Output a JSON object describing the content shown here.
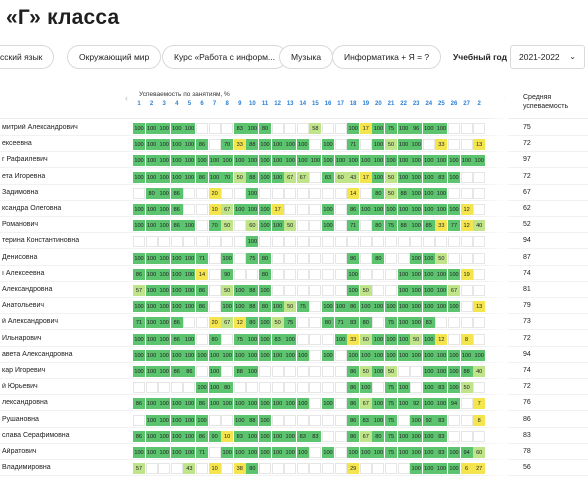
{
  "page": {
    "title": "«Г» класса"
  },
  "subjects": [
    "сский язык",
    "Окружающий мир",
    "Курс «Работа с информ...",
    "Музыка",
    "Информатика + Я = ?"
  ],
  "year": {
    "label": "Учебный год",
    "value": "2021-2022"
  },
  "performance": {
    "label": "Успеваемость по занятиям, %",
    "days": [
      "1",
      "2",
      "3",
      "4",
      "5",
      "6",
      "7",
      "8",
      "9",
      "10",
      "11",
      "12",
      "13",
      "14",
      "15",
      "16",
      "17",
      "18",
      "19",
      "20",
      "21",
      "22",
      "23",
      "24",
      "25",
      "26",
      "27",
      "2"
    ]
  },
  "average": {
    "label_line1": "Средняя",
    "label_line2": "успеваемость"
  },
  "colors": {
    "green": "#5cc36e",
    "yellow": "#f4e54f",
    "light_green": "#bfe48a",
    "accent": "#2a7fd6"
  },
  "students": [
    {
      "name": "митрий Александрович",
      "avg": "75",
      "cells": [
        "100",
        "100",
        "100",
        "100",
        "100",
        "",
        "",
        "",
        "83",
        "100",
        "80",
        "",
        "",
        "",
        "58",
        "",
        "",
        "100",
        "17",
        "100",
        "75",
        "100",
        "96",
        "100",
        "100",
        "",
        "",
        "",
        ""
      ]
    },
    {
      "name": "ексеевна",
      "avg": "72",
      "cells": [
        "100",
        "100",
        "100",
        "100",
        "100",
        "86",
        "",
        "70",
        "33",
        "88",
        "100",
        "100",
        "100",
        "100",
        "",
        "100",
        "",
        "71",
        "",
        "100",
        "50",
        "100",
        "100",
        "",
        "33",
        "",
        "",
        "13",
        "5"
      ]
    },
    {
      "name": "г Рафаилевич",
      "avg": "97",
      "cells": [
        "100",
        "100",
        "100",
        "100",
        "100",
        "100",
        "100",
        "100",
        "100",
        "100",
        "100",
        "100",
        "100",
        "100",
        "100",
        "100",
        "100",
        "100",
        "100",
        "100",
        "100",
        "100",
        "100",
        "100",
        "100",
        "100",
        "100",
        "100",
        "100"
      ]
    },
    {
      "name": "ета Игоревна",
      "avg": "72",
      "cells": [
        "100",
        "100",
        "100",
        "100",
        "100",
        "86",
        "100",
        "70",
        "50",
        "88",
        "100",
        "100",
        "67",
        "67",
        "",
        "83",
        "60",
        "43",
        "17",
        "100",
        "50",
        "100",
        "100",
        "100",
        "83",
        "100",
        "",
        "",
        ""
      ]
    },
    {
      "name": "Задимовна",
      "avg": "67",
      "cells": [
        "",
        "80",
        "100",
        "86",
        "",
        "",
        "20",
        "",
        "",
        "100",
        "",
        "",
        "",
        "",
        "",
        "",
        "",
        "14",
        "",
        "80",
        "50",
        "88",
        "100",
        "100",
        "100",
        "",
        "",
        "",
        ""
      ]
    },
    {
      "name": "ксандра Олеговна",
      "avg": "62",
      "cells": [
        "100",
        "100",
        "100",
        "86",
        "",
        "",
        "10",
        "67",
        "100",
        "100",
        "100",
        "17",
        "",
        "",
        "",
        "100",
        "",
        "86",
        "100",
        "100",
        "100",
        "100",
        "100",
        "100",
        "100",
        "100",
        "12",
        "",
        "1"
      ]
    },
    {
      "name": "Романович",
      "avg": "52",
      "cells": [
        "100",
        "100",
        "100",
        "86",
        "100",
        "",
        "70",
        "50",
        "",
        "60",
        "100",
        "100",
        "50",
        "",
        "",
        "100",
        "",
        "71",
        "",
        "80",
        "75",
        "88",
        "100",
        "85",
        "33",
        "77",
        "12",
        "40",
        "5"
      ]
    },
    {
      "name": "терина Константиновна",
      "avg": "94",
      "cells": [
        "",
        "",
        "",
        "",
        "",
        "",
        "",
        "",
        "",
        "100",
        "",
        "",
        "",
        "",
        "",
        "",
        "",
        "",
        "",
        "",
        "",
        "",
        "",
        "",
        "",
        "",
        "",
        "",
        ""
      ]
    },
    {
      "name": " Денисовна",
      "avg": "87",
      "cells": [
        "100",
        "100",
        "100",
        "100",
        "100",
        "71",
        "",
        "100",
        "",
        "75",
        "80",
        "",
        "",
        "",
        "",
        "",
        "",
        "86",
        "",
        "80",
        "",
        "",
        "100",
        "100",
        "50",
        "",
        "",
        "",
        ""
      ]
    },
    {
      "name": "ı Алексеевна",
      "avg": "74",
      "cells": [
        "86",
        "100",
        "100",
        "100",
        "100",
        "14",
        "",
        "90",
        "",
        "",
        "80",
        "",
        "",
        "",
        "",
        "",
        "",
        "100",
        "",
        "",
        "",
        "100",
        "100",
        "100",
        "100",
        "100",
        "19",
        "",
        ""
      ]
    },
    {
      "name": "Александровна",
      "avg": "81",
      "cells": [
        "57",
        "100",
        "100",
        "100",
        "100",
        "86",
        "",
        "50",
        "100",
        "88",
        "100",
        "",
        "",
        "",
        "",
        "",
        "",
        "100",
        "50",
        "",
        "",
        "100",
        "100",
        "100",
        "100",
        "67",
        "",
        "",
        ""
      ]
    },
    {
      "name": " Анатольевич",
      "avg": "79",
      "cells": [
        "100",
        "100",
        "100",
        "100",
        "100",
        "86",
        "",
        "100",
        "100",
        "88",
        "80",
        "100",
        "50",
        "75",
        "",
        "100",
        "100",
        "86",
        "100",
        "100",
        "100",
        "100",
        "100",
        "100",
        "100",
        "100",
        "",
        "13",
        "1"
      ]
    },
    {
      "name": "й Александрович",
      "avg": "73",
      "cells": [
        "71",
        "100",
        "100",
        "86",
        "",
        "",
        "20",
        "67",
        "12",
        "80",
        "100",
        "50",
        "75",
        "",
        "",
        "80",
        "71",
        "83",
        "80",
        "",
        "75",
        "100",
        "100",
        "83",
        "",
        "",
        "",
        "",
        ""
      ]
    },
    {
      "name": " Ильнарович",
      "avg": "72",
      "cells": [
        "100",
        "100",
        "100",
        "86",
        "100",
        "",
        "80",
        "",
        "75",
        "100",
        "100",
        "83",
        "100",
        "",
        "",
        "",
        "100",
        "33",
        "60",
        "100",
        "100",
        "100",
        "50",
        "100",
        "12",
        "",
        "8",
        "",
        ""
      ]
    },
    {
      "name": "авета Александровна",
      "avg": "94",
      "cells": [
        "100",
        "100",
        "100",
        "100",
        "100",
        "100",
        "100",
        "100",
        "100",
        "100",
        "100",
        "100",
        "100",
        "100",
        "",
        "100",
        "",
        "100",
        "100",
        "100",
        "100",
        "100",
        "100",
        "100",
        "100",
        "100",
        "100",
        "100",
        "100"
      ]
    },
    {
      "name": "кар Игоревич",
      "avg": "74",
      "cells": [
        "100",
        "100",
        "100",
        "86",
        "86",
        "",
        "100",
        "",
        "88",
        "100",
        "",
        "",
        "",
        "",
        "",
        "",
        "",
        "86",
        "50",
        "100",
        "50",
        "",
        "",
        "100",
        "100",
        "100",
        "88",
        "40",
        "5"
      ]
    },
    {
      "name": "й Юрьевич",
      "avg": "72",
      "cells": [
        "",
        "",
        "",
        "",
        "",
        "100",
        "100",
        "80",
        "",
        "",
        "",
        "",
        "",
        "",
        "",
        "",
        "",
        "86",
        "100",
        "",
        "75",
        "100",
        "",
        "100",
        "83",
        "100",
        "50",
        "",
        ""
      ]
    },
    {
      "name": "лександровна",
      "avg": "76",
      "cells": [
        "86",
        "100",
        "100",
        "100",
        "100",
        "86",
        "100",
        "100",
        "100",
        "100",
        "100",
        "100",
        "100",
        "100",
        "",
        "100",
        "",
        "86",
        "67",
        "100",
        "75",
        "100",
        "92",
        "100",
        "100",
        "94",
        "",
        "7",
        ""
      ]
    },
    {
      "name": "Рушановна",
      "avg": "86",
      "cells": [
        "",
        "100",
        "100",
        "100",
        "100",
        "100",
        "",
        "",
        "100",
        "88",
        "100",
        "",
        "",
        "",
        "",
        "",
        "",
        "86",
        "83",
        "100",
        "75",
        "",
        "100",
        "92",
        "83",
        "",
        "",
        "8",
        ""
      ]
    },
    {
      "name": "слава Серафимовна",
      "avg": "83",
      "cells": [
        "86",
        "100",
        "100",
        "100",
        "100",
        "86",
        "90",
        "10",
        "83",
        "100",
        "100",
        "100",
        "100",
        "83",
        "83",
        "",
        "",
        "86",
        "67",
        "80",
        "75",
        "100",
        "100",
        "100",
        "83",
        "",
        "",
        "",
        ""
      ]
    },
    {
      "name": "Айратович",
      "avg": "78",
      "cells": [
        "100",
        "100",
        "100",
        "100",
        "100",
        "71",
        "",
        "100",
        "100",
        "100",
        "100",
        "100",
        "100",
        "100",
        "",
        "100",
        "",
        "100",
        "100",
        "100",
        "75",
        "100",
        "100",
        "100",
        "83",
        "100",
        "94",
        "60",
        "7"
      ]
    },
    {
      "name": "Владимировна",
      "avg": "56",
      "cells": [
        "57",
        "",
        "",
        "",
        "43",
        "",
        "10",
        "",
        "38",
        "80",
        "",
        "",
        "",
        "",
        "",
        "",
        "",
        "29",
        "",
        "",
        "",
        "",
        "100",
        "100",
        "100",
        "100",
        "6",
        "27",
        "7"
      ]
    }
  ]
}
